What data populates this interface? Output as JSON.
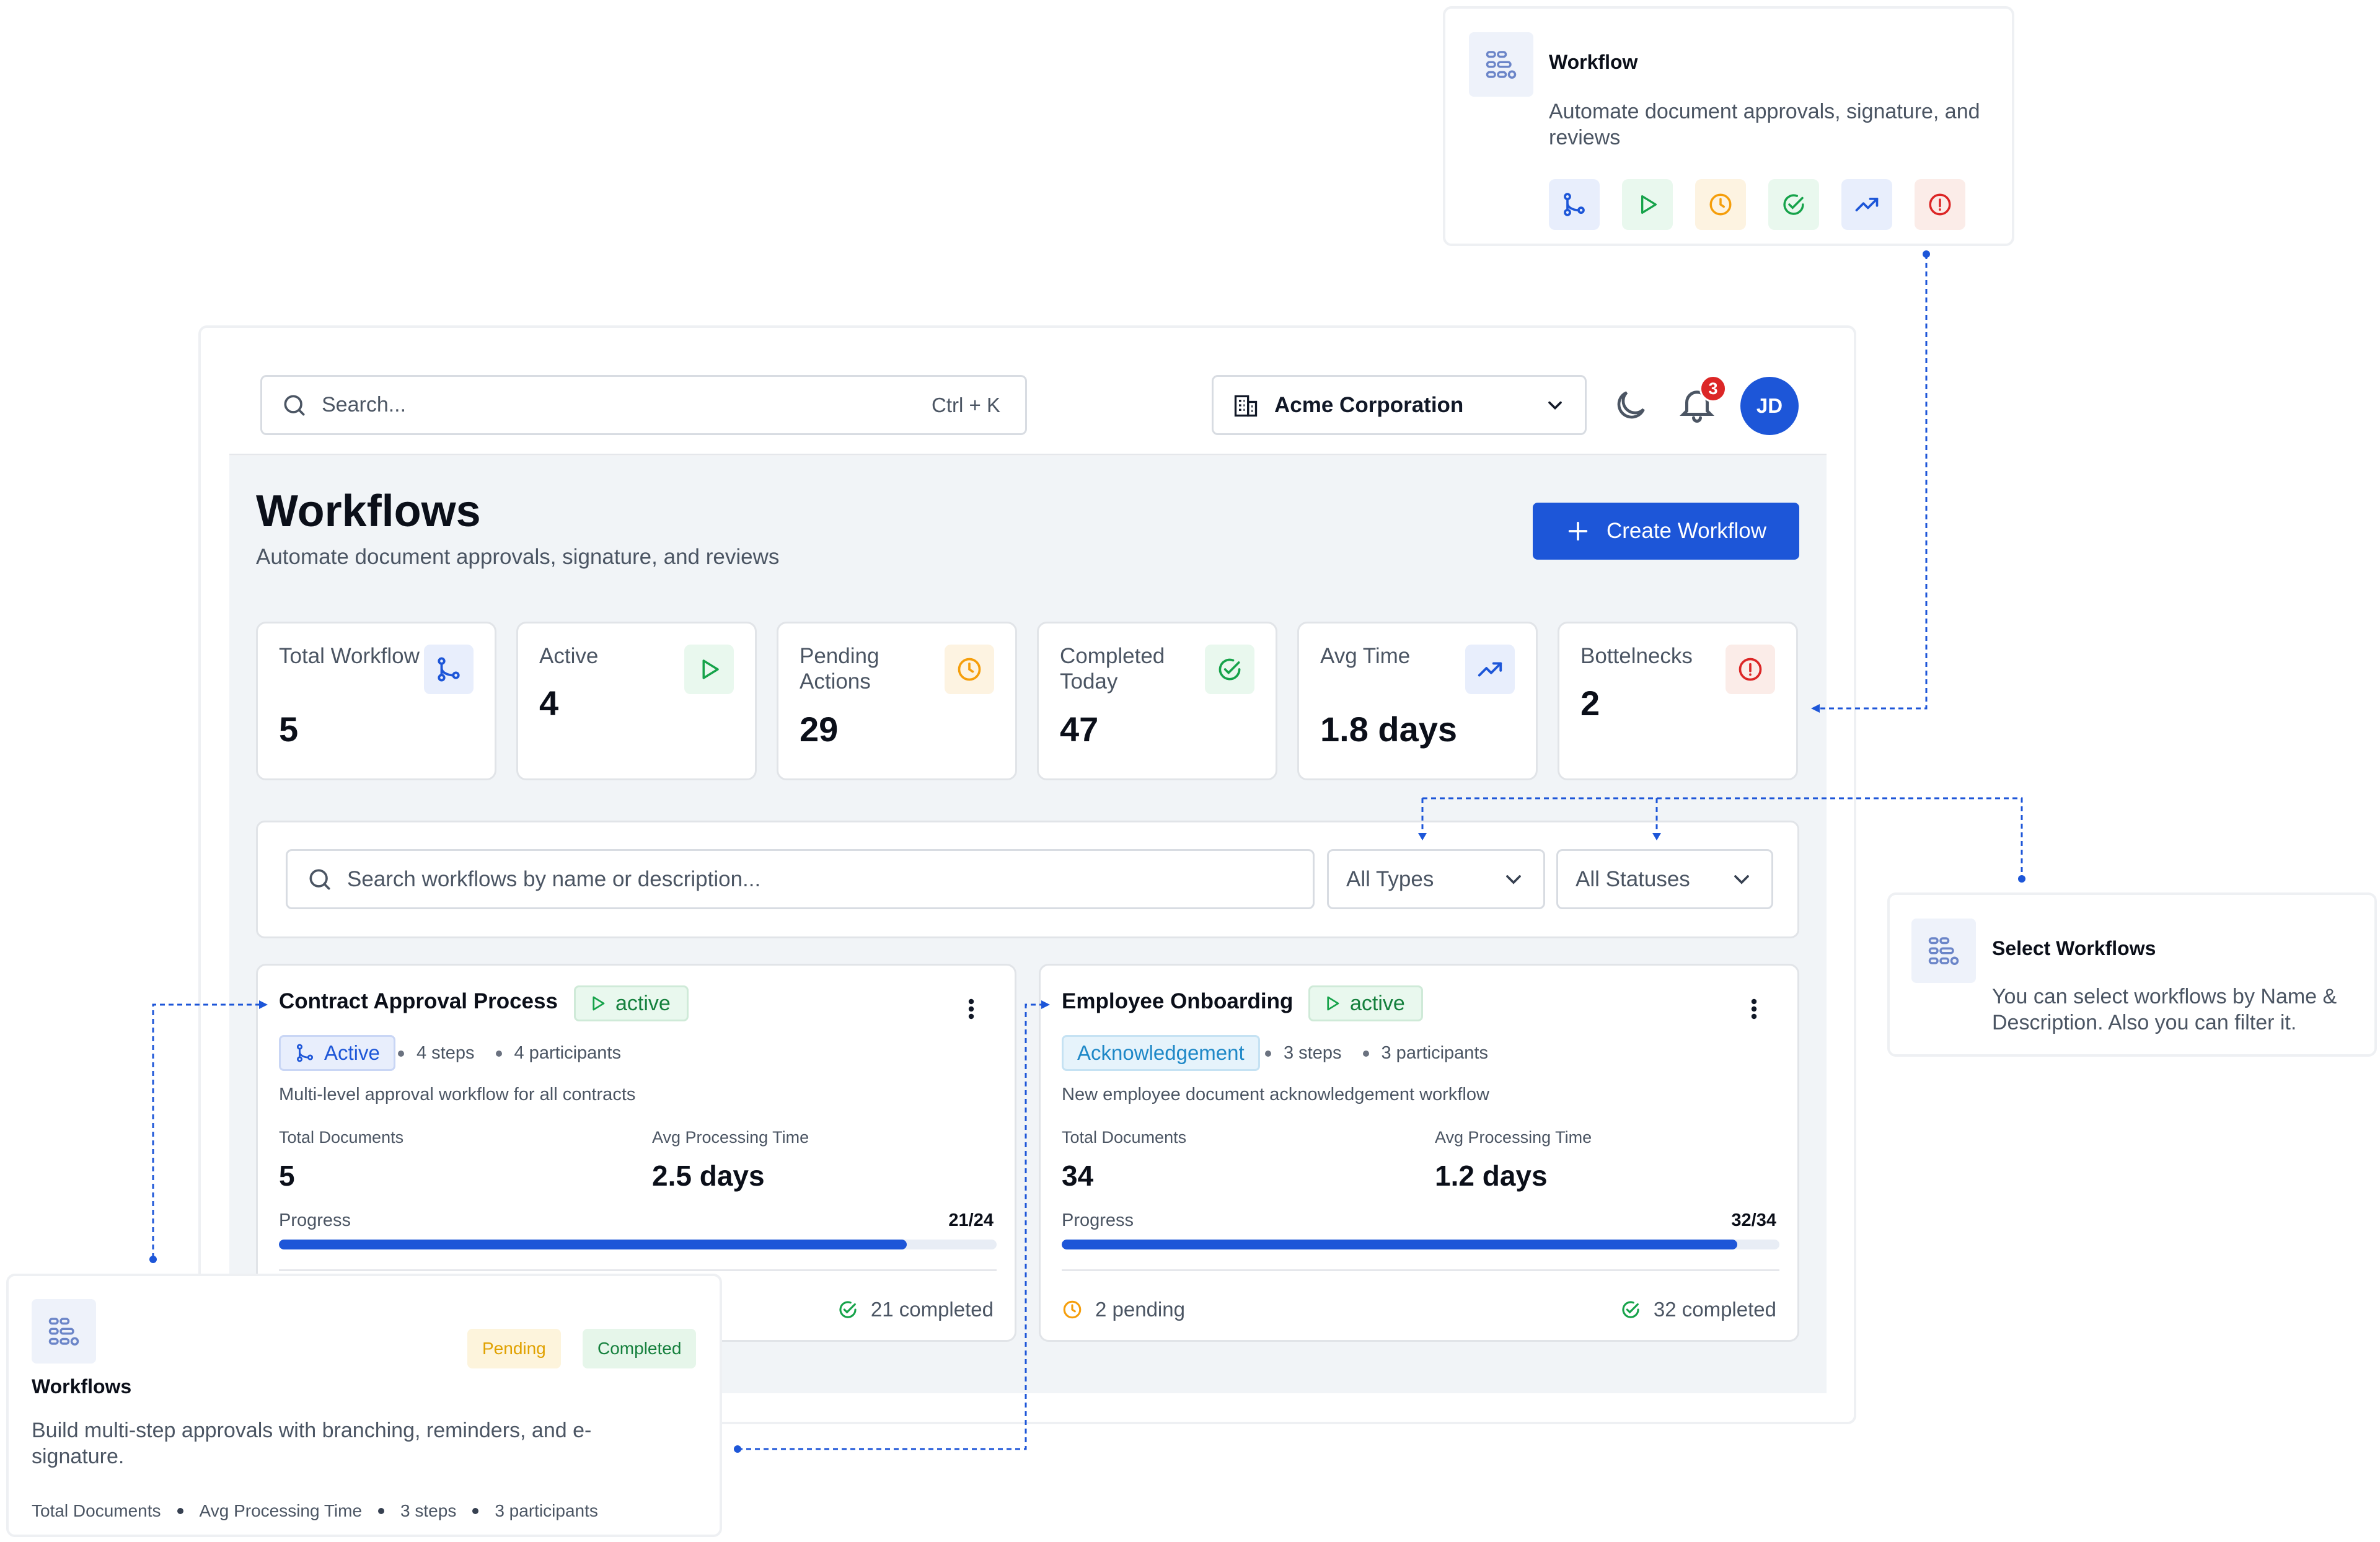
{
  "topbar": {
    "search_placeholder": "Search...",
    "search_shortcut": "Ctrl + K",
    "company": "Acme Corporation",
    "notification_count": "3",
    "avatar_initials": "JD"
  },
  "page": {
    "title": "Workflows",
    "subtitle": "Automate document approvals, signature, and reviews",
    "create_button": "Create Workflow"
  },
  "stats": [
    {
      "label": "Total Workflow",
      "value": "5",
      "icon": "git-branch-icon",
      "color": "#1d56d8",
      "bg": "#e8eefc"
    },
    {
      "label": "Active",
      "value": "4",
      "icon": "play-icon",
      "color": "#16a34a",
      "bg": "#e9f8ee"
    },
    {
      "label": "Pending Actions",
      "value": "29",
      "icon": "clock-icon",
      "color": "#f59e0b",
      "bg": "#fdf3e1"
    },
    {
      "label": "Completed Today",
      "value": "47",
      "icon": "check-circle-icon",
      "color": "#16a34a",
      "bg": "#e9f8ee"
    },
    {
      "label": "Avg Time",
      "value": "1.8 days",
      "icon": "trending-up-icon",
      "color": "#1d56d8",
      "bg": "#e8eefc"
    },
    {
      "label": "Bottelnecks",
      "value": "2",
      "icon": "alert-circle-icon",
      "color": "#dc2626",
      "bg": "#fbece8"
    }
  ],
  "filters": {
    "search_placeholder": "Search workflows by name or description...",
    "types": "All Types",
    "statuses": "All Statuses"
  },
  "workflows": [
    {
      "title": "Contract Approval Process",
      "status": "active",
      "type": "Active",
      "steps": "4 steps",
      "participants": "4 participants",
      "description": "Multi-level approval workflow for all contracts",
      "total_documents_label": "Total Documents",
      "total_documents": "5",
      "avg_time_label": "Avg Processing Time",
      "avg_time": "2.5 days",
      "progress_label": "Progress",
      "progress_text": "21/24",
      "progress": 0.875,
      "completed": "21 completed"
    },
    {
      "title": "Employee Onboarding",
      "status": "active",
      "type": "Acknowledgement",
      "steps": "3 steps",
      "participants": "3 participants",
      "description": "New employee document acknowledgement workflow",
      "total_documents_label": "Total Documents",
      "total_documents": "34",
      "avg_time_label": "Avg Processing Time",
      "avg_time": "1.2 days",
      "progress_label": "Progress",
      "progress_text": "32/34",
      "progress": 0.941,
      "pending": "2 pending",
      "completed": "32 completed"
    }
  ],
  "callout_workflow": {
    "title": "Workflow",
    "text": "Automate document approvals, signature, and reviews"
  },
  "callout_select": {
    "title": "Select Workflows",
    "text": "You can select workflows by Name & Description. Also you can filter it."
  },
  "callout_workflows": {
    "title": "Workflows",
    "text": "Build multi-step approvals with branching, reminders, and e-signature.",
    "chip_pending": "Pending",
    "chip_completed": "Completed",
    "meta": [
      "Total Documents",
      "Avg Processing Time",
      "3 steps",
      "3 participants"
    ]
  },
  "colors": {
    "primary": "#1d56d8",
    "success": "#16a34a",
    "warning": "#f59e0b",
    "danger": "#dc2626"
  }
}
